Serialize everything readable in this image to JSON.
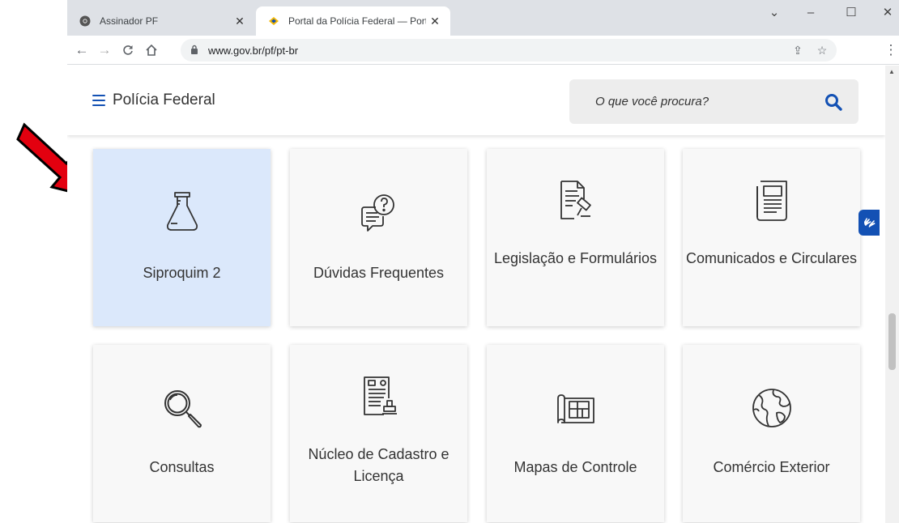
{
  "browser": {
    "tabs": [
      {
        "title": "Assinador PF",
        "close": "✕"
      },
      {
        "title": "Portal da Polícia Federal — Portu",
        "close": "✕"
      }
    ],
    "url": "www.gov.br/pf/pt-br",
    "window_controls": {
      "chevron": "⌄",
      "minimize": "–",
      "maximize": "☐",
      "close": "✕"
    }
  },
  "header": {
    "site_title": "Polícia Federal",
    "search_placeholder": "O que você procura?"
  },
  "cards": [
    {
      "label": "Siproquim 2",
      "icon": "flask-icon",
      "active": true
    },
    {
      "label": "Dúvidas Frequentes",
      "icon": "faq-chat-icon"
    },
    {
      "label": "Legislação e Formulários",
      "icon": "document-gavel-icon"
    },
    {
      "label": "Comunicados e Circulares",
      "icon": "newspaper-icon"
    },
    {
      "label": "Consultas",
      "icon": "magnifier-icon"
    },
    {
      "label": "Núcleo de Cadastro e Licença",
      "icon": "registry-stamp-icon"
    },
    {
      "label": "Mapas de Controle",
      "icon": "map-plan-icon"
    },
    {
      "label": "Comércio Exterior",
      "icon": "globe-icon"
    }
  ],
  "colors": {
    "accent": "#1351b4",
    "active_card": "#dbe8fb",
    "annotation_arrow": "#e3000f"
  }
}
